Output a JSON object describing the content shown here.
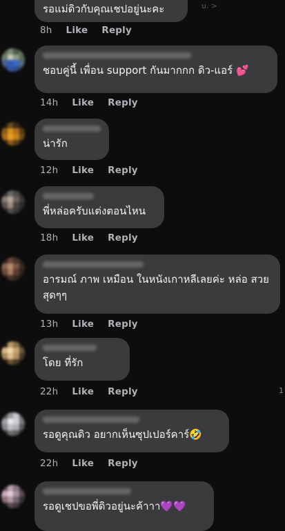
{
  "comments": [
    {
      "text": "รอแม่ดิวกับคุณเชปอยู่นะคะ",
      "time": "8h",
      "like": "Like",
      "reply": "Reply"
    },
    {
      "text": "ชอบคู่นี้ เพื่อน support กันมากกก ดิว-แอร์",
      "emoji": "💕",
      "time": "14h",
      "like": "Like",
      "reply": "Reply"
    },
    {
      "text": "น่ารัก",
      "time": "12h",
      "like": "Like",
      "reply": "Reply"
    },
    {
      "text": "พี่หล่อครับแต่งตอนไหน",
      "time": "18h",
      "like": "Like",
      "reply": "Reply"
    },
    {
      "text": "อารมณ์ ภาพ เหมือน ในหนังเกาหลีเลยค่ะ หล่อ สวย สุดๆๆ",
      "time": "13h",
      "like": "Like",
      "reply": "Reply"
    },
    {
      "text": "โดย ที่รัก",
      "time": "22h",
      "like": "Like",
      "reply": "Reply"
    },
    {
      "text": "รอดูคุณดิว อยากเห็นซุปเปอร์คาร์",
      "emoji": "🤣",
      "time": "22h",
      "like": "Like",
      "reply": "Reply"
    },
    {
      "text": "รอดูเชปขอพี่ดิวอยู่นะค้าาา",
      "emoji": "💜💜",
      "time": "",
      "like": "",
      "reply": ""
    }
  ],
  "scroll_indicator": "1",
  "top_fragment": "u. >",
  "colors": {
    "bubble": "#3a3b3c",
    "background": "#0d0d0d",
    "meta": "#b0b3b8"
  }
}
